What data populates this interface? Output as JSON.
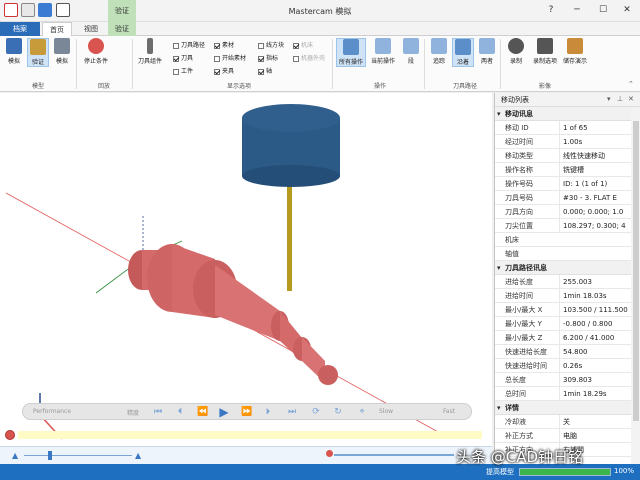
{
  "window": {
    "title": "Mastercam 模拟",
    "context_tab": "验证"
  },
  "tabs": [
    {
      "label": "档案"
    },
    {
      "label": "首页"
    },
    {
      "label": "视图"
    },
    {
      "label": "验证"
    }
  ],
  "ribbon": {
    "model_group": {
      "label": "模型",
      "buttons": [
        "模拟",
        "验证",
        "模拟"
      ]
    },
    "playback_group": {
      "label": "回放",
      "buttons": [
        "停止条件"
      ]
    },
    "display_group": {
      "label": "显示选项",
      "tool_combo": "刀具组件",
      "checkboxes": [
        {
          "label": "刀具路径",
          "checked": false,
          "disabled": false
        },
        {
          "label": "刀具",
          "checked": true,
          "disabled": false
        },
        {
          "label": "工件",
          "checked": false,
          "disabled": false
        },
        {
          "label": "素材",
          "checked": true,
          "disabled": false
        },
        {
          "label": "开始素材",
          "checked": false,
          "disabled": false
        },
        {
          "label": "夹具",
          "checked": true,
          "disabled": false
        },
        {
          "label": "线方块",
          "checked": false,
          "disabled": false
        },
        {
          "label": "指标",
          "checked": true,
          "disabled": false
        },
        {
          "label": "轴",
          "checked": true,
          "disabled": false
        },
        {
          "label": "机床",
          "checked": true,
          "disabled": true
        },
        {
          "label": "机器外壳",
          "checked": false,
          "disabled": true
        }
      ]
    },
    "operation_group": {
      "label": "操作",
      "buttons": [
        "所有操作",
        "当前操作",
        "段"
      ]
    },
    "toolpath_group": {
      "label": "刀具路径",
      "buttons": [
        "追踪",
        "沿着",
        "两者"
      ]
    },
    "video_group": {
      "label": "影像",
      "buttons": [
        "录制",
        "录制选项",
        "储存演示"
      ]
    }
  },
  "playback": {
    "performance_label": "Performance",
    "precision_label": "精度",
    "slow_label": "Slow",
    "fast_label": "Fast"
  },
  "panel": {
    "title": "移动列表",
    "sections": [
      {
        "title": "移动讯息",
        "rows": [
          {
            "k": "移动 ID",
            "v": "1 of 65"
          },
          {
            "k": "经过时间",
            "v": "1.00s"
          },
          {
            "k": "移动类型",
            "v": "线性快速移动"
          },
          {
            "k": "操作名称",
            "v": "铣键槽"
          },
          {
            "k": "操作号码",
            "v": "ID: 1 (1 of 1)"
          },
          {
            "k": "刀具号码",
            "v": "#30 -     3. FLAT E"
          },
          {
            "k": "刀具方向",
            "v": "0.000; 0.000; 1.0"
          },
          {
            "k": "刀尖位置",
            "v": "108.297; 0.300; 4"
          },
          {
            "k": "机床",
            "v": ""
          },
          {
            "k": "轴值",
            "v": ""
          }
        ]
      },
      {
        "title": "刀具路径讯息",
        "rows": [
          {
            "k": "进给长度",
            "v": "255.003"
          },
          {
            "k": "进给时间",
            "v": "1min 18.03s"
          },
          {
            "k": "最小/最大 X",
            "v": "103.500 / 111.500"
          },
          {
            "k": "最小/最大 Y",
            "v": "-0.800 / 0.800"
          },
          {
            "k": "最小/最大 Z",
            "v": "6.200 / 41.000"
          },
          {
            "k": "快速进给长度",
            "v": "54.800"
          },
          {
            "k": "快速进给时间",
            "v": "0.26s"
          },
          {
            "k": "总长度",
            "v": "309.803"
          },
          {
            "k": "总时间",
            "v": "1min 18.29s"
          }
        ]
      },
      {
        "title": "详情",
        "rows": [
          {
            "k": "冷却液",
            "v": "关"
          },
          {
            "k": "补正方式",
            "v": "电脑"
          },
          {
            "k": "补正方向",
            "v": "右補間"
          }
        ]
      }
    ]
  },
  "status": {
    "label": "提高模型",
    "progress": 1.0,
    "percent_text": "100%"
  },
  "watermark": "头条 @CAD钟日铭",
  "colors": {
    "accent": "#1e6fbf",
    "part": "#d46a6a",
    "tool": "#2b5a86",
    "shank": "#b59a1d"
  }
}
